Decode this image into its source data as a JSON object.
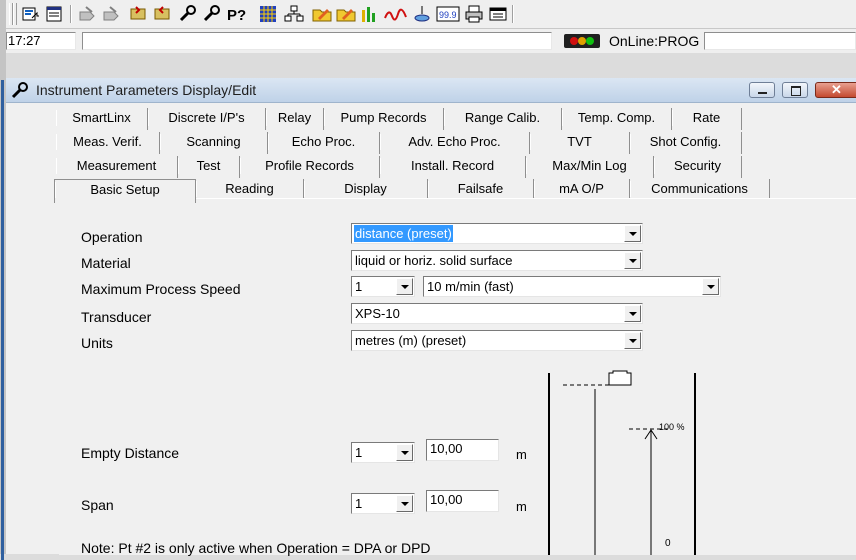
{
  "toolbar": {
    "icons": [
      "open-icon",
      "print-preview-icon",
      "read-icon",
      "write-icon",
      "upload-icon",
      "download-icon",
      "wrench-icon",
      "wrench-icon",
      "parameter-query-icon",
      "grid-icon",
      "network-icon",
      "edit-folder-icon",
      "edit-folder-icon",
      "bar-graph-icon",
      "waveform-icon",
      "tank-icon",
      "display-99-icon",
      "printer-icon",
      "window-icon"
    ]
  },
  "status": {
    "time": "17:27",
    "connection": "OnLine:PROG"
  },
  "window": {
    "title": "Instrument Parameters Display/Edit"
  },
  "tabs": {
    "row1": [
      "SmartLinx",
      "Discrete I/P's",
      "Relay",
      "Pump Records",
      "Range Calib.",
      "Temp. Comp.",
      "Rate"
    ],
    "row2": [
      "Meas. Verif.",
      "Scanning",
      "Echo Proc.",
      "Adv. Echo Proc.",
      "TVT",
      "Shot Config."
    ],
    "row3": [
      "Measurement",
      "Test",
      "Profile Records",
      "Install. Record",
      "Max/Min Log",
      "Security"
    ],
    "row4": [
      "Basic Setup",
      "Reading",
      "Display",
      "Failsafe",
      "mA O/P",
      "Communications"
    ],
    "selected": "Basic Setup"
  },
  "form": {
    "operation": {
      "label": "Operation",
      "value": "distance (preset)"
    },
    "material": {
      "label": "Material",
      "value": "liquid or horiz. solid surface"
    },
    "speed": {
      "label": "Maximum Process Speed",
      "point": "1",
      "value": "10  m/min (fast)"
    },
    "transducer": {
      "label": "Transducer",
      "value": "XPS-10"
    },
    "units": {
      "label": "Units",
      "value": "metres (m) (preset)"
    },
    "empty": {
      "label": "Empty Distance",
      "point": "1",
      "value": "10,00",
      "unit": "m"
    },
    "span": {
      "label": "Span",
      "point": "1",
      "value": "10,00",
      "unit": "m"
    },
    "note": "Note: Pt #2 is only active when Operation = DPA or DPD"
  },
  "diagram": {
    "top_label": "100 %",
    "bottom_label": "0"
  }
}
